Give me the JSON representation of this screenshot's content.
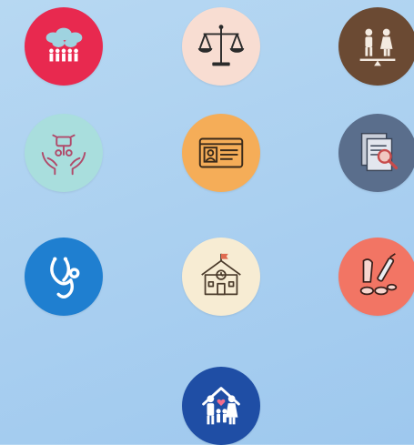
{
  "tiles": [
    {
      "icon": "community-icon",
      "color": "#e8294f"
    },
    {
      "icon": "justice-scales-icon",
      "color": "#f8ddd2"
    },
    {
      "icon": "gender-equality-icon",
      "color": "#6b4a33"
    },
    {
      "icon": "hands-care-icon",
      "color": "#a9dedd"
    },
    {
      "icon": "id-card-icon",
      "color": "#f5ad58"
    },
    {
      "icon": "document-search-icon",
      "color": "#5a6e8c"
    },
    {
      "icon": "stethoscope-icon",
      "color": "#1f7fd0"
    },
    {
      "icon": "school-icon",
      "color": "#f7ecd3"
    },
    {
      "icon": "medicine-icon",
      "color": "#f27564"
    },
    {
      "icon": "family-home-icon",
      "color": "#1f4ea5"
    }
  ]
}
